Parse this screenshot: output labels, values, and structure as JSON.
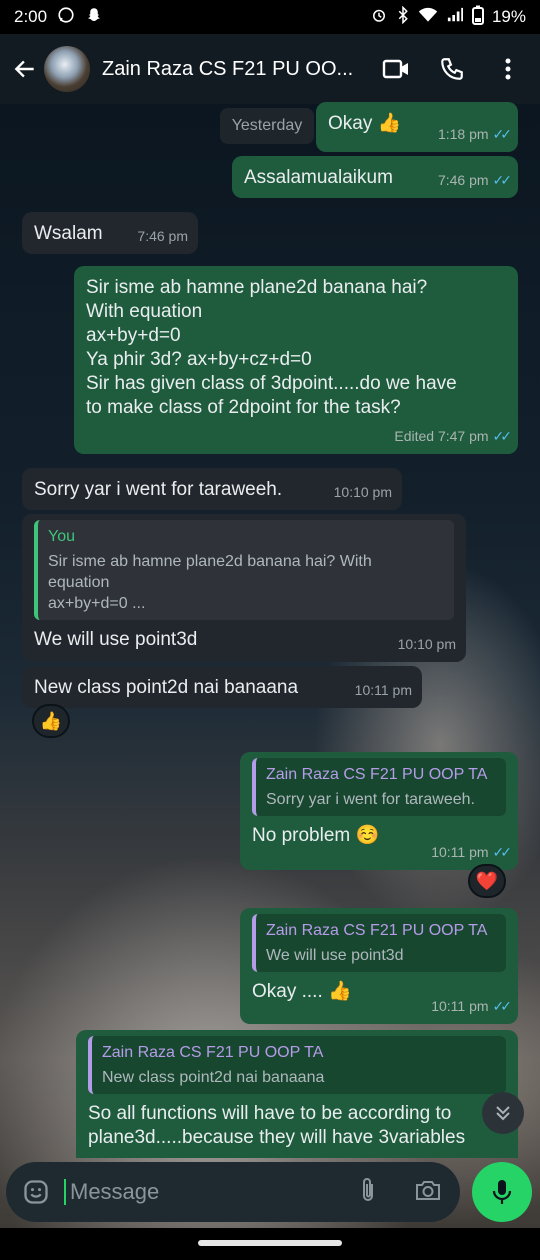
{
  "status_bar": {
    "time": "2:00",
    "battery": "19%"
  },
  "header": {
    "contact_name": "Zain Raza CS F21 PU OO..."
  },
  "chat": {
    "date_chip": "Yesterday",
    "messages": [
      {
        "text": "Okay 👍",
        "time": "1:18 pm"
      },
      {
        "text": "Assalamualaikum",
        "time": "7:46 pm"
      },
      {
        "text": "Wsalam",
        "time": "7:46 pm"
      },
      {
        "lines": [
          "Sir isme ab hamne plane2d banana hai?",
          "With equation",
          "ax+by+d=0",
          "Ya phir 3d? ax+by+cz+d=0",
          "Sir has given class of 3dpoint.....do we have",
          "to make class of 2dpoint for the task?"
        ],
        "time": "Edited 7:47 pm"
      },
      {
        "text": "Sorry yar i went for taraweeh.",
        "time": "10:10 pm"
      },
      {
        "quote_author": "You",
        "quote_lines": [
          "Sir isme ab hamne plane2d banana hai? With",
          "equation",
          "ax+by+d=0 ..."
        ],
        "text": "We will use point3d",
        "time": "10:10 pm"
      },
      {
        "text": "New class point2d nai banaana",
        "time": "10:11 pm",
        "reaction": "👍"
      },
      {
        "quote_author": "Zain Raza CS F21 PU OOP TA",
        "quote_text": "Sorry yar i went for taraweeh.",
        "text": "No problem ☺️",
        "time": "10:11 pm",
        "reaction": "❤️"
      },
      {
        "quote_author": "Zain Raza CS F21 PU OOP TA",
        "quote_text": "We will use point3d",
        "text": "Okay .... 👍",
        "time": "10:11 pm"
      },
      {
        "quote_author": "Zain Raza CS F21 PU OOP TA",
        "quote_text": "New class point2d nai banaana",
        "lines": [
          "So all functions will have to be according to",
          "plane3d.....because they will have 3variables"
        ]
      }
    ]
  },
  "composer": {
    "placeholder": "Message"
  },
  "colors": {
    "outgoing_bubble": "#1f5c3e",
    "incoming_bubble": "#22272d",
    "accent": "#25d366",
    "read_ticks": "#53bdeb"
  }
}
